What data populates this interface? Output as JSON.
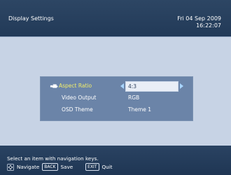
{
  "header": {
    "title": "Display Settings",
    "date": "Fri 04 Sep 2009",
    "time": "16:22:07"
  },
  "settings": {
    "items": [
      {
        "label": "Aspect Ratio",
        "value": "4:3"
      },
      {
        "label": "Video Output",
        "value": "RGB"
      },
      {
        "label": "OSD Theme",
        "value": "Theme 1"
      }
    ]
  },
  "footer": {
    "help": "Select an item with navigation keys.",
    "navigate_label": "Navigate",
    "back_key": "BACK",
    "save_label": "Save",
    "exit_key": "EXIT",
    "quit_label": "Quit"
  },
  "colors": {
    "header_bg": "#223a58",
    "content_bg": "#c7d3e5",
    "panel_bg": "#6b84a8",
    "selected_label": "#f2ee6a",
    "value_box_bg": "#e9eef6",
    "arrow": "#a8d5ff"
  },
  "icons": {
    "pointer": "hand-pointer-icon",
    "navigate": "navigation-keys-icon"
  }
}
